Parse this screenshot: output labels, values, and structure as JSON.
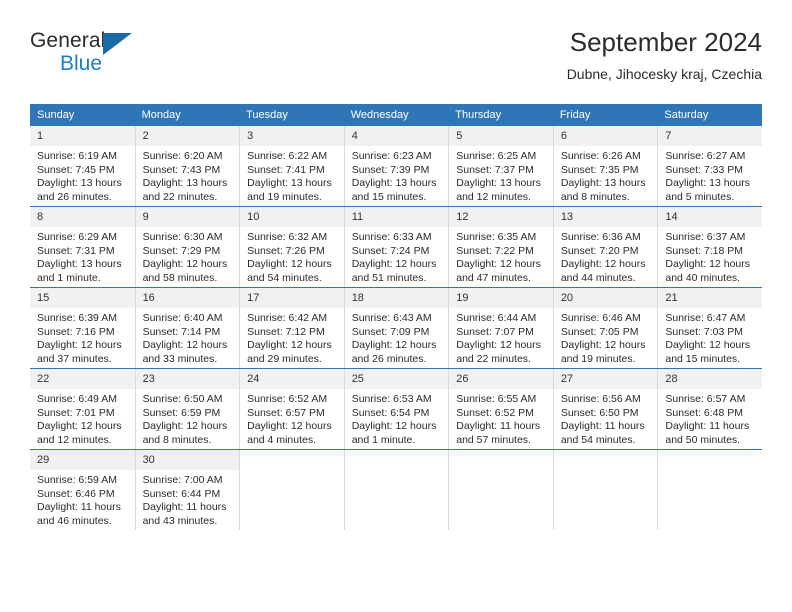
{
  "brand": {
    "name_top": "General",
    "name_bottom": "Blue",
    "triangle_icon": "blue-triangle-logo-mark",
    "color_dark": "#2b2b2b",
    "color_blue": "#1f7fc4"
  },
  "header": {
    "title": "September 2024",
    "subtitle": "Dubne, Jihocesky kraj, Czechia"
  },
  "theme": {
    "header_blue": "#2f76b6",
    "daynum_band": "#f1f1f1",
    "grid_line": "#d9d9d9",
    "text": "#2b2b2b"
  },
  "weekdays": [
    "Sunday",
    "Monday",
    "Tuesday",
    "Wednesday",
    "Thursday",
    "Friday",
    "Saturday"
  ],
  "weeks": [
    [
      {
        "day": "1",
        "sunrise": "Sunrise: 6:19 AM",
        "sunset": "Sunset: 7:45 PM",
        "daylight_1": "Daylight: 13 hours",
        "daylight_2": "and 26 minutes."
      },
      {
        "day": "2",
        "sunrise": "Sunrise: 6:20 AM",
        "sunset": "Sunset: 7:43 PM",
        "daylight_1": "Daylight: 13 hours",
        "daylight_2": "and 22 minutes."
      },
      {
        "day": "3",
        "sunrise": "Sunrise: 6:22 AM",
        "sunset": "Sunset: 7:41 PM",
        "daylight_1": "Daylight: 13 hours",
        "daylight_2": "and 19 minutes."
      },
      {
        "day": "4",
        "sunrise": "Sunrise: 6:23 AM",
        "sunset": "Sunset: 7:39 PM",
        "daylight_1": "Daylight: 13 hours",
        "daylight_2": "and 15 minutes."
      },
      {
        "day": "5",
        "sunrise": "Sunrise: 6:25 AM",
        "sunset": "Sunset: 7:37 PM",
        "daylight_1": "Daylight: 13 hours",
        "daylight_2": "and 12 minutes."
      },
      {
        "day": "6",
        "sunrise": "Sunrise: 6:26 AM",
        "sunset": "Sunset: 7:35 PM",
        "daylight_1": "Daylight: 13 hours",
        "daylight_2": "and 8 minutes."
      },
      {
        "day": "7",
        "sunrise": "Sunrise: 6:27 AM",
        "sunset": "Sunset: 7:33 PM",
        "daylight_1": "Daylight: 13 hours",
        "daylight_2": "and 5 minutes."
      }
    ],
    [
      {
        "day": "8",
        "sunrise": "Sunrise: 6:29 AM",
        "sunset": "Sunset: 7:31 PM",
        "daylight_1": "Daylight: 13 hours",
        "daylight_2": "and 1 minute."
      },
      {
        "day": "9",
        "sunrise": "Sunrise: 6:30 AM",
        "sunset": "Sunset: 7:29 PM",
        "daylight_1": "Daylight: 12 hours",
        "daylight_2": "and 58 minutes."
      },
      {
        "day": "10",
        "sunrise": "Sunrise: 6:32 AM",
        "sunset": "Sunset: 7:26 PM",
        "daylight_1": "Daylight: 12 hours",
        "daylight_2": "and 54 minutes."
      },
      {
        "day": "11",
        "sunrise": "Sunrise: 6:33 AM",
        "sunset": "Sunset: 7:24 PM",
        "daylight_1": "Daylight: 12 hours",
        "daylight_2": "and 51 minutes."
      },
      {
        "day": "12",
        "sunrise": "Sunrise: 6:35 AM",
        "sunset": "Sunset: 7:22 PM",
        "daylight_1": "Daylight: 12 hours",
        "daylight_2": "and 47 minutes."
      },
      {
        "day": "13",
        "sunrise": "Sunrise: 6:36 AM",
        "sunset": "Sunset: 7:20 PM",
        "daylight_1": "Daylight: 12 hours",
        "daylight_2": "and 44 minutes."
      },
      {
        "day": "14",
        "sunrise": "Sunrise: 6:37 AM",
        "sunset": "Sunset: 7:18 PM",
        "daylight_1": "Daylight: 12 hours",
        "daylight_2": "and 40 minutes."
      }
    ],
    [
      {
        "day": "15",
        "sunrise": "Sunrise: 6:39 AM",
        "sunset": "Sunset: 7:16 PM",
        "daylight_1": "Daylight: 12 hours",
        "daylight_2": "and 37 minutes."
      },
      {
        "day": "16",
        "sunrise": "Sunrise: 6:40 AM",
        "sunset": "Sunset: 7:14 PM",
        "daylight_1": "Daylight: 12 hours",
        "daylight_2": "and 33 minutes."
      },
      {
        "day": "17",
        "sunrise": "Sunrise: 6:42 AM",
        "sunset": "Sunset: 7:12 PM",
        "daylight_1": "Daylight: 12 hours",
        "daylight_2": "and 29 minutes."
      },
      {
        "day": "18",
        "sunrise": "Sunrise: 6:43 AM",
        "sunset": "Sunset: 7:09 PM",
        "daylight_1": "Daylight: 12 hours",
        "daylight_2": "and 26 minutes."
      },
      {
        "day": "19",
        "sunrise": "Sunrise: 6:44 AM",
        "sunset": "Sunset: 7:07 PM",
        "daylight_1": "Daylight: 12 hours",
        "daylight_2": "and 22 minutes."
      },
      {
        "day": "20",
        "sunrise": "Sunrise: 6:46 AM",
        "sunset": "Sunset: 7:05 PM",
        "daylight_1": "Daylight: 12 hours",
        "daylight_2": "and 19 minutes."
      },
      {
        "day": "21",
        "sunrise": "Sunrise: 6:47 AM",
        "sunset": "Sunset: 7:03 PM",
        "daylight_1": "Daylight: 12 hours",
        "daylight_2": "and 15 minutes."
      }
    ],
    [
      {
        "day": "22",
        "sunrise": "Sunrise: 6:49 AM",
        "sunset": "Sunset: 7:01 PM",
        "daylight_1": "Daylight: 12 hours",
        "daylight_2": "and 12 minutes."
      },
      {
        "day": "23",
        "sunrise": "Sunrise: 6:50 AM",
        "sunset": "Sunset: 6:59 PM",
        "daylight_1": "Daylight: 12 hours",
        "daylight_2": "and 8 minutes."
      },
      {
        "day": "24",
        "sunrise": "Sunrise: 6:52 AM",
        "sunset": "Sunset: 6:57 PM",
        "daylight_1": "Daylight: 12 hours",
        "daylight_2": "and 4 minutes."
      },
      {
        "day": "25",
        "sunrise": "Sunrise: 6:53 AM",
        "sunset": "Sunset: 6:54 PM",
        "daylight_1": "Daylight: 12 hours",
        "daylight_2": "and 1 minute."
      },
      {
        "day": "26",
        "sunrise": "Sunrise: 6:55 AM",
        "sunset": "Sunset: 6:52 PM",
        "daylight_1": "Daylight: 11 hours",
        "daylight_2": "and 57 minutes."
      },
      {
        "day": "27",
        "sunrise": "Sunrise: 6:56 AM",
        "sunset": "Sunset: 6:50 PM",
        "daylight_1": "Daylight: 11 hours",
        "daylight_2": "and 54 minutes."
      },
      {
        "day": "28",
        "sunrise": "Sunrise: 6:57 AM",
        "sunset": "Sunset: 6:48 PM",
        "daylight_1": "Daylight: 11 hours",
        "daylight_2": "and 50 minutes."
      }
    ],
    [
      {
        "day": "29",
        "sunrise": "Sunrise: 6:59 AM",
        "sunset": "Sunset: 6:46 PM",
        "daylight_1": "Daylight: 11 hours",
        "daylight_2": "and 46 minutes."
      },
      {
        "day": "30",
        "sunrise": "Sunrise: 7:00 AM",
        "sunset": "Sunset: 6:44 PM",
        "daylight_1": "Daylight: 11 hours",
        "daylight_2": "and 43 minutes."
      },
      {
        "day": "",
        "sunrise": "",
        "sunset": "",
        "daylight_1": "",
        "daylight_2": ""
      },
      {
        "day": "",
        "sunrise": "",
        "sunset": "",
        "daylight_1": "",
        "daylight_2": ""
      },
      {
        "day": "",
        "sunrise": "",
        "sunset": "",
        "daylight_1": "",
        "daylight_2": ""
      },
      {
        "day": "",
        "sunrise": "",
        "sunset": "",
        "daylight_1": "",
        "daylight_2": ""
      },
      {
        "day": "",
        "sunrise": "",
        "sunset": "",
        "daylight_1": "",
        "daylight_2": ""
      }
    ]
  ]
}
